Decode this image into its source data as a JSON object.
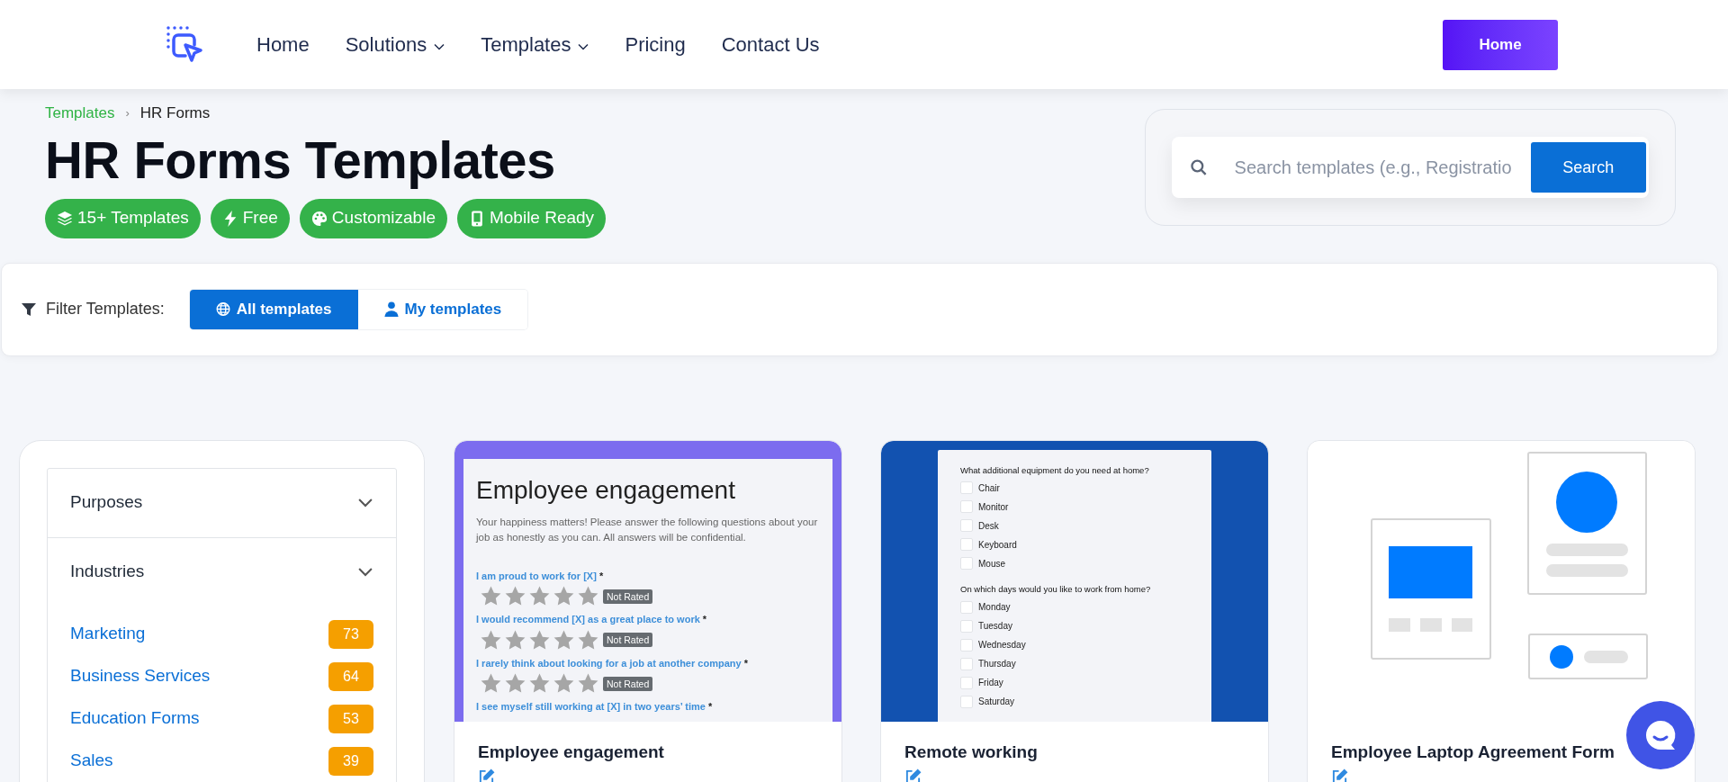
{
  "nav": {
    "items": [
      {
        "label": "Home",
        "dropdown": false
      },
      {
        "label": "Solutions",
        "dropdown": true
      },
      {
        "label": "Templates",
        "dropdown": true
      },
      {
        "label": "Pricing",
        "dropdown": false
      },
      {
        "label": "Contact Us",
        "dropdown": false
      }
    ],
    "button": "Home"
  },
  "breadcrumb": {
    "items": [
      "Templates",
      "HR Forms"
    ],
    "separator": "›"
  },
  "title": "HR Forms Templates",
  "badges": [
    {
      "label": "15+ Templates",
      "kind": "layers"
    },
    {
      "label": "Free",
      "kind": "bolt"
    },
    {
      "label": "Customizable",
      "kind": "palette"
    },
    {
      "label": "Mobile Ready",
      "kind": "mobile"
    }
  ],
  "search": {
    "placeholder": "Search templates (e.g., Registratio",
    "button": "Search"
  },
  "filter": {
    "label": "Filter Templates:",
    "tabs": [
      {
        "label": "All templates",
        "kind": "globe",
        "selected": true
      },
      {
        "label": "My templates",
        "kind": "user",
        "selected": false
      }
    ]
  },
  "sidebar": {
    "sections": [
      {
        "label": "Purposes"
      },
      {
        "label": "Industries",
        "items": [
          {
            "label": "Marketing",
            "count": "73"
          },
          {
            "label": "Business Services",
            "count": "64"
          },
          {
            "label": "Education Forms",
            "count": "53"
          },
          {
            "label": "Sales",
            "count": "39"
          }
        ]
      }
    ]
  },
  "templates": [
    {
      "title": "Employee engagement",
      "preview": {
        "kind": "rating",
        "heading": "Employee engagement",
        "description": "Your happiness matters! Please answer the following questions about your job as honestly as you can. All answers will be confidential.",
        "questions": [
          {
            "label": "I am proud to work for [X]",
            "required_mark": "*",
            "stars": 0,
            "rating_label": "Not Rated"
          },
          {
            "label": "I would recommend [X] as a great place to work",
            "required_mark": "*",
            "stars": 0,
            "rating_label": "Not Rated"
          },
          {
            "label": "I rarely think about looking for a job at another company",
            "required_mark": "*",
            "stars": 0,
            "rating_label": "Not Rated"
          },
          {
            "label": "I see myself still working at [X] in two years’ time",
            "required_mark": "*"
          }
        ]
      }
    },
    {
      "title": "Remote working",
      "preview": {
        "kind": "checklist",
        "groups": [
          {
            "question": "What additional equipment do you need at home?",
            "options": [
              {
                "label": "Chair",
                "checked": false
              },
              {
                "label": "Monitor",
                "checked": false
              },
              {
                "label": "Desk",
                "checked": false
              },
              {
                "label": "Keyboard",
                "checked": false
              },
              {
                "label": "Mouse",
                "checked": false
              }
            ]
          },
          {
            "question": "On which days would you like to work from home?",
            "options": [
              {
                "label": "Monday",
                "checked": false
              },
              {
                "label": "Tuesday",
                "checked": false
              },
              {
                "label": "Wednesday",
                "checked": false
              },
              {
                "label": "Thursday",
                "checked": false
              },
              {
                "label": "Friday",
                "checked": false
              },
              {
                "label": "Saturday",
                "checked": false
              }
            ]
          }
        ]
      }
    },
    {
      "title": "Employee Laptop Agreement Form",
      "preview": {
        "kind": "illustration"
      }
    }
  ]
}
